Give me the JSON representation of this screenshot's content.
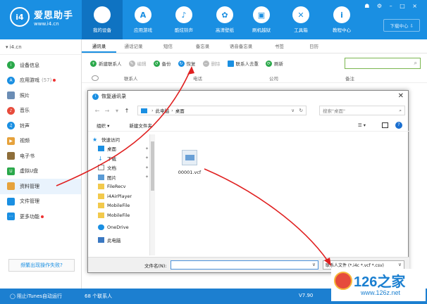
{
  "app": {
    "logo_mark": "i4",
    "logo_title": "爱思助手",
    "logo_url": "www.i4.cn",
    "window_controls": "☗ ⚙ – □ ×",
    "download_center": "下载中心 ⇩"
  },
  "nav": [
    {
      "label": "我的设备",
      "icon": "apple-icon",
      "glyph": "",
      "active": true
    },
    {
      "label": "应用游戏",
      "icon": "app-store-icon",
      "glyph": "A"
    },
    {
      "label": "酷炫铃声",
      "icon": "bell-icon",
      "glyph": "♪"
    },
    {
      "label": "高清壁纸",
      "icon": "flower-icon",
      "glyph": "✿"
    },
    {
      "label": "刷机越狱",
      "icon": "box-icon",
      "glyph": "▣"
    },
    {
      "label": "工具箱",
      "icon": "tools-icon",
      "glyph": "✕"
    },
    {
      "label": "教程中心",
      "icon": "info-icon",
      "glyph": "i"
    }
  ],
  "sidebar": {
    "device": "▾  i4.cn",
    "items": [
      {
        "label": "设备信息",
        "icon": "info-icon",
        "color": "#2aa84a"
      },
      {
        "label": "应用游戏",
        "icon": "app-icon",
        "color": "#1a8fe2",
        "badge": "(57)"
      },
      {
        "label": "照片",
        "icon": "photo-icon",
        "color": "#6b8db5"
      },
      {
        "label": "音乐",
        "icon": "music-icon",
        "color": "#e74c3c"
      },
      {
        "label": "铃声",
        "icon": "bell-icon",
        "color": "#1a8fe2"
      },
      {
        "label": "视频",
        "icon": "video-icon",
        "color": "#e6a23c"
      },
      {
        "label": "电子书",
        "icon": "book-icon",
        "color": "#8e6e3a"
      },
      {
        "label": "虚拟U盘",
        "icon": "usb-icon",
        "color": "#2aa84a"
      },
      {
        "label": "资料管理",
        "icon": "data-icon",
        "color": "#e6a23c",
        "active": true
      },
      {
        "label": "文件管理",
        "icon": "file-icon",
        "color": "#1a8fe2"
      },
      {
        "label": "更多功能",
        "icon": "more-icon",
        "color": "#1a8fe2"
      }
    ],
    "help": "频繁出现操作失败?"
  },
  "tabs": [
    "通讯录",
    "通话记录",
    "短信",
    "备忘录",
    "语音备忘录",
    "书签",
    "日历"
  ],
  "toolbar": [
    {
      "label": "新建联系人",
      "icon": "add-icon",
      "color": "#2aa84a"
    },
    {
      "label": "编辑",
      "icon": "edit-icon",
      "color": "#bbb",
      "disabled": true
    },
    {
      "label": "备份",
      "icon": "backup-icon",
      "color": "#2aa84a"
    },
    {
      "label": "恢复",
      "icon": "restore-icon",
      "color": "#1a8fe2"
    },
    {
      "label": "删除",
      "icon": "delete-icon",
      "color": "#bbb",
      "disabled": true
    },
    {
      "label": "联系人去重",
      "icon": "dedupe-icon",
      "color": "#1a8fe2"
    },
    {
      "label": "刷新",
      "icon": "refresh-icon",
      "color": "#2aa84a"
    }
  ],
  "columns": [
    "联系人",
    "电话",
    "公司",
    "备注"
  ],
  "status": {
    "itunes": "◯ 阻止iTunes自动运行",
    "count": "68 个联系人",
    "version": "V7.90"
  },
  "dialog": {
    "title": "恢复通讯录",
    "close": "✕",
    "path_root": "此电脑",
    "path_current": "桌面",
    "search_placeholder": "搜索\"桌面\"",
    "organize": "组织 ▾",
    "new_folder": "新建文件夹",
    "view": "☰ ▾",
    "help": "?",
    "tree": [
      {
        "label": "快速访问",
        "icon": "star-icon",
        "indent": 0
      },
      {
        "label": "桌面",
        "icon": "desktop-icon",
        "indent": 1,
        "pinned": true
      },
      {
        "label": "下载",
        "icon": "download-icon",
        "indent": 1,
        "pinned": true
      },
      {
        "label": "文档",
        "icon": "document-icon",
        "indent": 1,
        "pinned": true
      },
      {
        "label": "图片",
        "icon": "picture-icon",
        "indent": 1,
        "pinned": true
      },
      {
        "label": "FileRecv",
        "icon": "folder-icon",
        "indent": 1
      },
      {
        "label": "i4AirPlayer",
        "icon": "folder-icon",
        "indent": 1
      },
      {
        "label": "MobileFile",
        "icon": "folder-icon",
        "indent": 1
      },
      {
        "label": "MobileFile",
        "icon": "folder-icon",
        "indent": 1
      },
      {
        "label": "OneDrive",
        "icon": "cloud-icon",
        "indent": 0
      },
      {
        "label": "此电脑",
        "icon": "computer-icon",
        "indent": 0
      }
    ],
    "file": "00001.vcf",
    "filename_label": "文件名(N):",
    "filename_value": "",
    "filetype": "联系人文件 (*.i4c *.vcf *.csv)"
  },
  "watermark": {
    "brand": "126之家",
    "url": "www.126z.net"
  }
}
